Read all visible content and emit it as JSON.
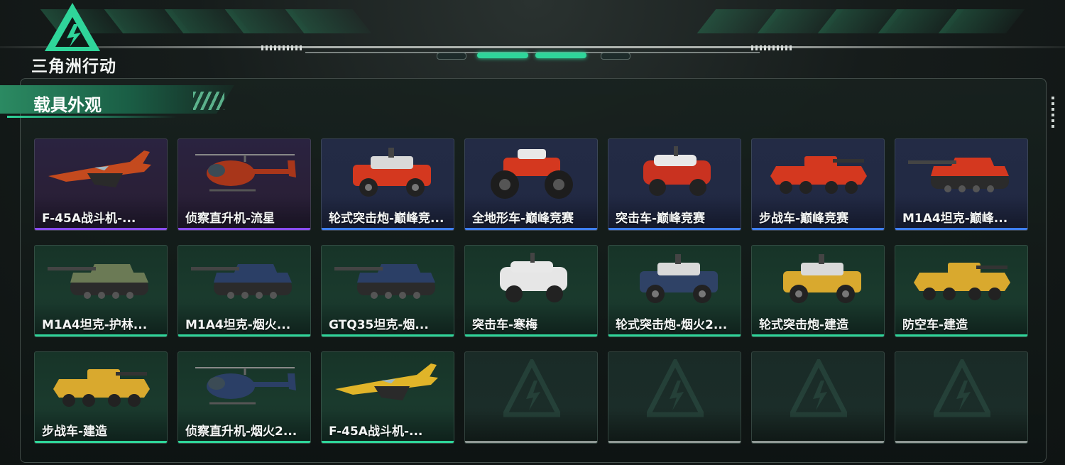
{
  "header": {
    "logo_text": "三角洲行动"
  },
  "panel": {
    "title": "载具外观"
  },
  "colors": {
    "accent": "#2fd59a",
    "rarity_purple": "#8a4df0",
    "rarity_blue": "#3f7ff0",
    "rarity_green": "#2fd59a",
    "empty": "#8f9895"
  },
  "vehicles": [
    {
      "name": "F-45A战斗机-...",
      "rarity": "purple",
      "icon": "fighter-jet-icon"
    },
    {
      "name": "侦察直升机-流星",
      "rarity": "purple",
      "icon": "helicopter-icon"
    },
    {
      "name": "轮式突击炮-巅峰竞...",
      "rarity": "blue",
      "icon": "armored-car-icon"
    },
    {
      "name": "全地形车-巅峰竞赛",
      "rarity": "blue",
      "icon": "atv-icon"
    },
    {
      "name": "突击车-巅峰竞赛",
      "rarity": "blue",
      "icon": "assault-car-icon"
    },
    {
      "name": "步战车-巅峰竞赛",
      "rarity": "blue",
      "icon": "ifv-icon"
    },
    {
      "name": "M1A4坦克-巅峰...",
      "rarity": "blue",
      "icon": "tank-icon"
    },
    {
      "name": "M1A4坦克-护林...",
      "rarity": "green",
      "icon": "tank-icon"
    },
    {
      "name": "M1A4坦克-烟火...",
      "rarity": "green",
      "icon": "tank-icon"
    },
    {
      "name": "GTQ35坦克-烟...",
      "rarity": "green",
      "icon": "tank-icon"
    },
    {
      "name": "突击车-寒梅",
      "rarity": "green",
      "icon": "assault-car-icon"
    },
    {
      "name": "轮式突击炮-烟火2...",
      "rarity": "green",
      "icon": "armored-car-icon"
    },
    {
      "name": "轮式突击炮-建造",
      "rarity": "green",
      "icon": "armored-car-icon"
    },
    {
      "name": "防空车-建造",
      "rarity": "green",
      "icon": "ifv-icon"
    },
    {
      "name": "步战车-建造",
      "rarity": "green",
      "icon": "ifv-icon"
    },
    {
      "name": "侦察直升机-烟火2...",
      "rarity": "green",
      "icon": "helicopter-icon"
    },
    {
      "name": "F-45A战斗机-...",
      "rarity": "green",
      "icon": "fighter-jet-icon"
    },
    {
      "name": "",
      "rarity": "empty",
      "icon": "empty-slot-icon"
    },
    {
      "name": "",
      "rarity": "empty",
      "icon": "empty-slot-icon"
    },
    {
      "name": "",
      "rarity": "empty",
      "icon": "empty-slot-icon"
    },
    {
      "name": "",
      "rarity": "empty",
      "icon": "empty-slot-icon"
    }
  ]
}
